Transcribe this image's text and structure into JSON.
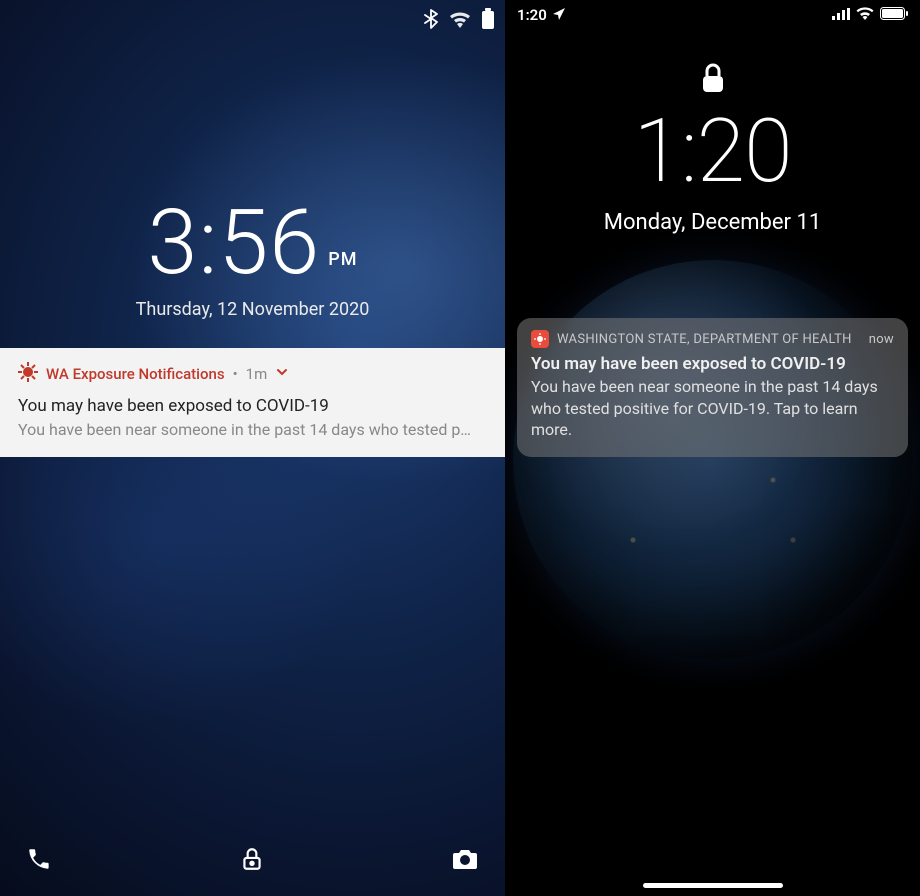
{
  "android": {
    "status": {
      "icons": [
        "bluetooth",
        "wifi",
        "battery"
      ]
    },
    "time": "3:56",
    "ampm": "PM",
    "date": "Thursday, 12 November 2020",
    "notification": {
      "app": "WA Exposure Notifications",
      "age": "1m",
      "title": "You may have been exposed to COVID-19",
      "body": "You have been near someone in the past 14 days who tested p…"
    },
    "bottom": {
      "left": "phone",
      "center": "lock",
      "right": "camera"
    }
  },
  "iphone": {
    "status": {
      "time": "1:20",
      "location": true,
      "icons": [
        "cellular",
        "wifi",
        "battery"
      ]
    },
    "time": "1:20",
    "date": "Monday, December 11",
    "notification": {
      "app": "WASHINGTON STATE, DEPARTMENT OF HEALTH",
      "age": "now",
      "title": "You may have been exposed to COVID-19",
      "body": "You have been near someone in the past 14 days who tested positive for COVID-19. Tap to learn more."
    }
  }
}
